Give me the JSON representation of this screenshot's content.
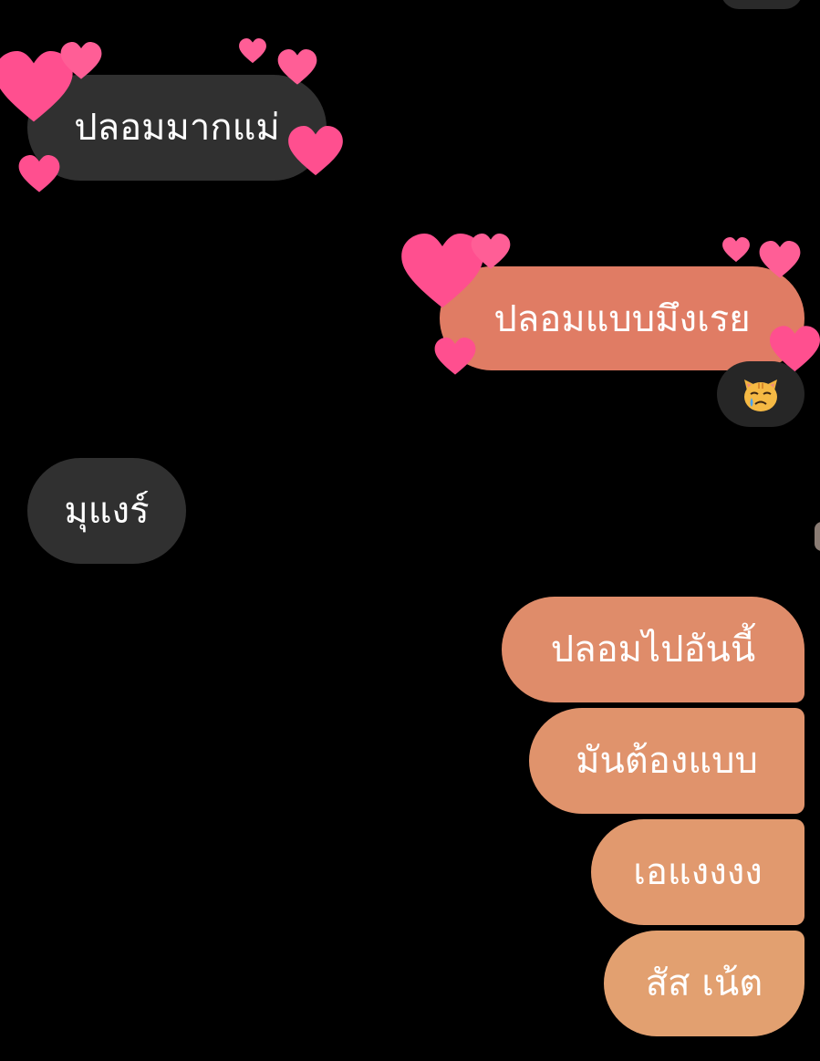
{
  "colors": {
    "background": "#000000",
    "incoming_bubble": "#303030",
    "heart": "#ff4f8f",
    "outgoing_gradient": [
      "#e07a63",
      "#e18c6a",
      "#e2a070"
    ]
  },
  "messages": [
    {
      "id": "m1",
      "direction": "incoming",
      "text": "ปลอมมากแม่",
      "reaction": "hearts"
    },
    {
      "id": "m2",
      "direction": "outgoing",
      "text": "ปลอมแบบมึงเรย",
      "reaction": "hearts"
    },
    {
      "id": "m3",
      "direction": "incoming",
      "text": "มุแงร์"
    },
    {
      "id": "m4",
      "direction": "outgoing",
      "text": "ปลอมไปอันนี้"
    },
    {
      "id": "m5",
      "direction": "outgoing",
      "text": "มันต้องแบบ"
    },
    {
      "id": "m6",
      "direction": "outgoing",
      "text": "เอแงงงง"
    },
    {
      "id": "m7",
      "direction": "outgoing",
      "text": "สัส เน้ต"
    }
  ],
  "reactions": {
    "m2_emoji": "😿",
    "m2_emoji_icon": "crying-cat-face-icon"
  }
}
